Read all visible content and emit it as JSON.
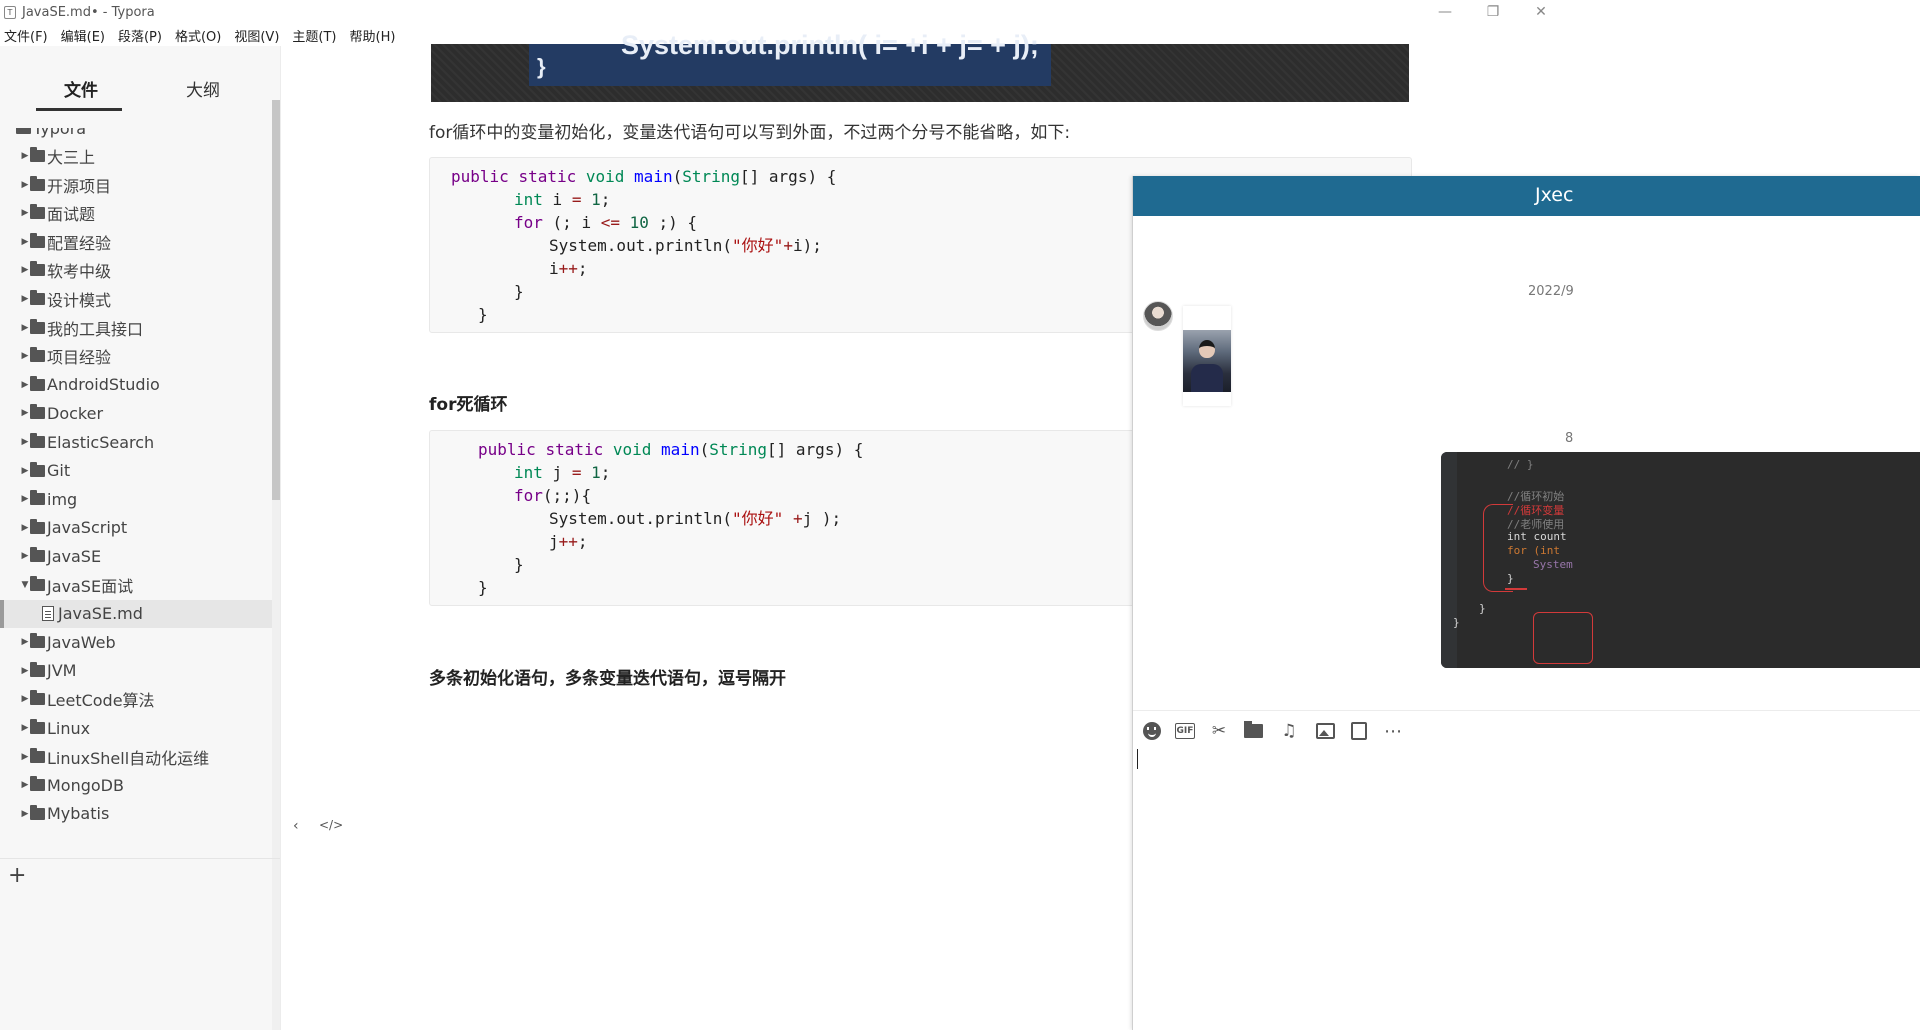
{
  "window": {
    "title": "JavaSE.md• - Typora"
  },
  "menubar": {
    "items": [
      "文件(F)",
      "编辑(E)",
      "段落(P)",
      "格式(O)",
      "视图(V)",
      "主题(T)",
      "帮助(H)"
    ]
  },
  "sidebar": {
    "tabs": [
      "文件",
      "大纲"
    ],
    "root": "Typora",
    "items": [
      {
        "label": "大三上",
        "type": "folder",
        "expanded": false
      },
      {
        "label": "开源项目",
        "type": "folder",
        "expanded": false
      },
      {
        "label": "面试题",
        "type": "folder",
        "expanded": false
      },
      {
        "label": "配置经验",
        "type": "folder",
        "expanded": false
      },
      {
        "label": "软考中级",
        "type": "folder",
        "expanded": false
      },
      {
        "label": "设计模式",
        "type": "folder",
        "expanded": false
      },
      {
        "label": "我的工具接口",
        "type": "folder",
        "expanded": false
      },
      {
        "label": "项目经验",
        "type": "folder",
        "expanded": false
      },
      {
        "label": "AndroidStudio",
        "type": "folder",
        "expanded": false
      },
      {
        "label": "Docker",
        "type": "folder",
        "expanded": false
      },
      {
        "label": "ElasticSearch",
        "type": "folder",
        "expanded": false
      },
      {
        "label": "Git",
        "type": "folder",
        "expanded": false
      },
      {
        "label": "img",
        "type": "folder",
        "expanded": false
      },
      {
        "label": "JavaScript",
        "type": "folder",
        "expanded": false
      },
      {
        "label": "JavaSE",
        "type": "folder",
        "expanded": false
      },
      {
        "label": "JavaSE面试",
        "type": "folder",
        "expanded": true
      },
      {
        "label": "JavaSE.md",
        "type": "file",
        "selected": true
      },
      {
        "label": "JavaWeb",
        "type": "folder",
        "expanded": false
      },
      {
        "label": "JVM",
        "type": "folder",
        "expanded": false
      },
      {
        "label": "LeetCode算法",
        "type": "folder",
        "expanded": false
      },
      {
        "label": "Linux",
        "type": "folder",
        "expanded": false
      },
      {
        "label": "LinuxShell自动化运维",
        "type": "folder",
        "expanded": false
      },
      {
        "label": "MongoDB",
        "type": "folder",
        "expanded": false
      },
      {
        "label": "Mybatis",
        "type": "folder",
        "expanded": false
      }
    ],
    "add_label": "+"
  },
  "editor": {
    "banner_line1": "System.out.println( i= +i + j= + j);",
    "banner_line2": "}",
    "para1": "for循环中的变量初始化，变量迭代语句可以写到外面，不过两个分号不能省略，如下:",
    "heading1": "for死循环",
    "heading2": "多条初始化语句，多条变量迭代语句，逗号隔开",
    "code1": [
      "public static void main(String[] args) {",
      "int i = 1;",
      "for (; i <= 10 ;) {",
      "System.out.println(\"你好\"+i);",
      "i++;",
      "}",
      "}"
    ],
    "code2": [
      "public static void main(String[] args) {",
      "int j = 1;",
      "for(;;){",
      "System.out.println(\"你好\" +j );",
      "j++;",
      "}",
      "}"
    ],
    "footer_back_icon": "chevron-left-icon",
    "footer_source_icon": "code-icon"
  },
  "chat": {
    "title": "Jxec",
    "timestamp": "2022/9",
    "second_timestamp_fragment": "8",
    "code_shot_lines": [
      "// }",
      "//循环初始",
      "//循环变量",
      "//老师使用",
      "int count",
      "for (int",
      "System",
      "}",
      "}",
      "}"
    ],
    "toolbar_icons": [
      "emoji-icon",
      "gif-icon",
      "scissors-icon",
      "folder-icon",
      "music-icon",
      "image-icon",
      "video-icon",
      "more-icon"
    ],
    "colors": {
      "header": "#1f6a91"
    }
  }
}
